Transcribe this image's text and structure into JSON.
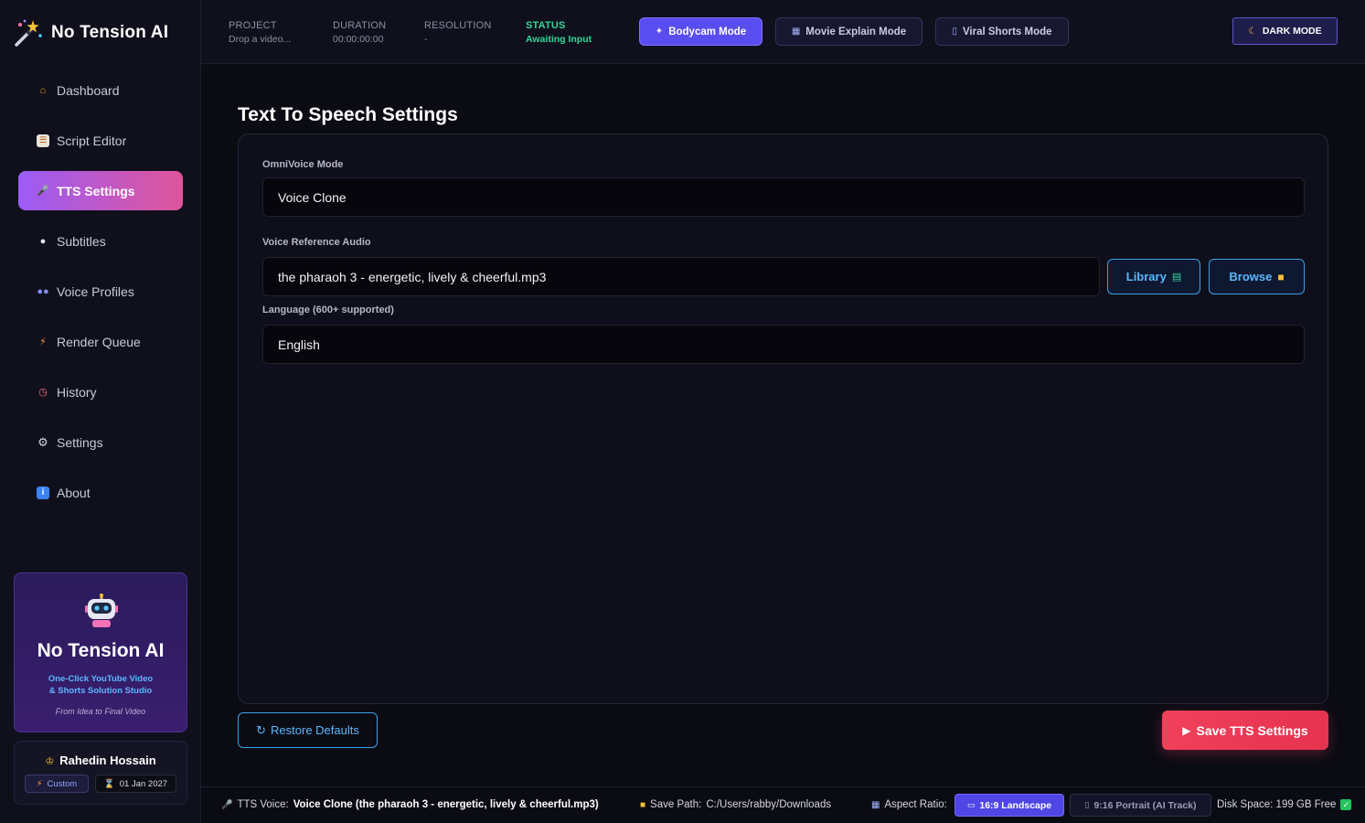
{
  "app": {
    "name": "No Tension AI"
  },
  "sidebar": {
    "items": [
      {
        "label": "Dashboard",
        "icon": "house-icon"
      },
      {
        "label": "Script Editor",
        "icon": "document-icon"
      },
      {
        "label": "TTS Settings",
        "icon": "microphone-icon",
        "active": true
      },
      {
        "label": "Subtitles",
        "icon": "speech-bubble-icon"
      },
      {
        "label": "Voice Profiles",
        "icon": "people-icon"
      },
      {
        "label": "Render Queue",
        "icon": "lightning-icon"
      },
      {
        "label": "History",
        "icon": "clock-icon"
      },
      {
        "label": "Settings",
        "icon": "gear-icon"
      },
      {
        "label": "About",
        "icon": "info-icon"
      }
    ],
    "promo": {
      "title": "No Tension AI",
      "subtitle_line1": "One-Click YouTube Video",
      "subtitle_line2": "& Shorts Solution Studio",
      "tagline": "From Idea to Final Video"
    },
    "user": {
      "name": "Rahedin Hossain",
      "plan": "Custom",
      "expiry": "01 Jan 2027"
    }
  },
  "topbar": {
    "project": {
      "label": "PROJECT",
      "value": "Drop a video..."
    },
    "duration": {
      "label": "DURATION",
      "value": "00:00:00:00"
    },
    "resolution": {
      "label": "RESOLUTION",
      "value": "-"
    },
    "status": {
      "label": "STATUS",
      "value": "Awaiting Input"
    },
    "modes": [
      {
        "label": "Bodycam Mode",
        "active": true
      },
      {
        "label": "Movie Explain Mode",
        "active": false
      },
      {
        "label": "Viral Shorts Mode",
        "active": false
      }
    ],
    "theme_button": "DARK MODE"
  },
  "main": {
    "title": "Text To Speech Settings",
    "omnivoice_label": "OmniVoice Mode",
    "omnivoice_value": "Voice Clone",
    "reference_label": "Voice Reference Audio",
    "reference_value": "the pharaoh 3 - energetic, lively & cheerful.mp3",
    "library_button": "Library",
    "browse_button": "Browse",
    "language_label": "Language (600+ supported)",
    "language_value": "English",
    "restore_button": "Restore Defaults",
    "save_button": "Save TTS Settings"
  },
  "footer": {
    "tts_voice_label": "TTS Voice:",
    "tts_voice_value": "Voice Clone (the pharaoh 3 - energetic, lively & cheerful.mp3)",
    "save_path_label": "Save Path:",
    "save_path_value": "C:/Users/rabby/Downloads",
    "aspect_label": "Aspect Ratio:",
    "aspect_options": [
      {
        "label": "16:9 Landscape",
        "active": true
      },
      {
        "label": "9:16 Portrait (AI Track)",
        "active": false
      }
    ],
    "disk_space": "Disk Space: 199 GB Free"
  },
  "colors": {
    "accent": "#5a4df0",
    "active_gradient_start": "#9b5cf6",
    "active_gradient_end": "#e0559a",
    "status_green": "#34d399",
    "link_blue": "#59b8ff",
    "save_red": "#f0405a"
  }
}
